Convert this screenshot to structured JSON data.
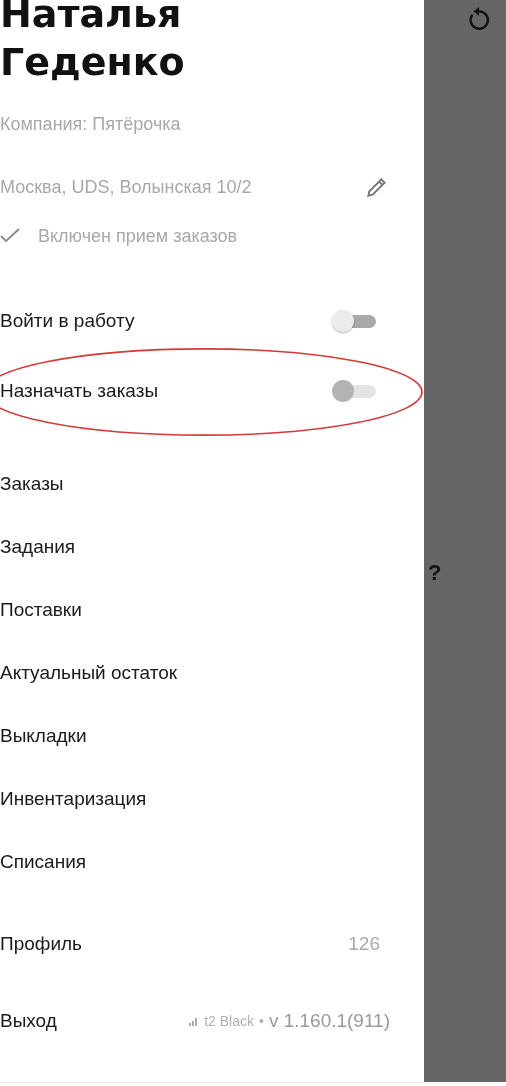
{
  "drawer": {
    "user_name": "Наталья Геденко",
    "company": "Компания: Пятёрочка",
    "address": "Москва, UDS, Волынская 10/2",
    "status": {
      "label": "Включен прием заказов",
      "checked": true
    },
    "toggles": [
      {
        "label": "Войти в работу",
        "on": false,
        "disabled": false,
        "highlighted": false
      },
      {
        "label": "Назначать заказы",
        "on": false,
        "disabled": true,
        "highlighted": true
      }
    ],
    "menu": [
      {
        "label": "Заказы"
      },
      {
        "label": "Задания"
      },
      {
        "label": "Поставки"
      },
      {
        "label": "Актуальный остаток"
      },
      {
        "label": "Выкладки"
      },
      {
        "label": "Инвентаризация"
      },
      {
        "label": "Списания"
      }
    ],
    "profile": {
      "label": "Профиль",
      "count": "126"
    },
    "footer": {
      "label": "Выход",
      "carrier": "t2 Black",
      "separator": "•",
      "version": "v 1.160.1(911)"
    }
  },
  "background": {
    "mark": "?"
  }
}
